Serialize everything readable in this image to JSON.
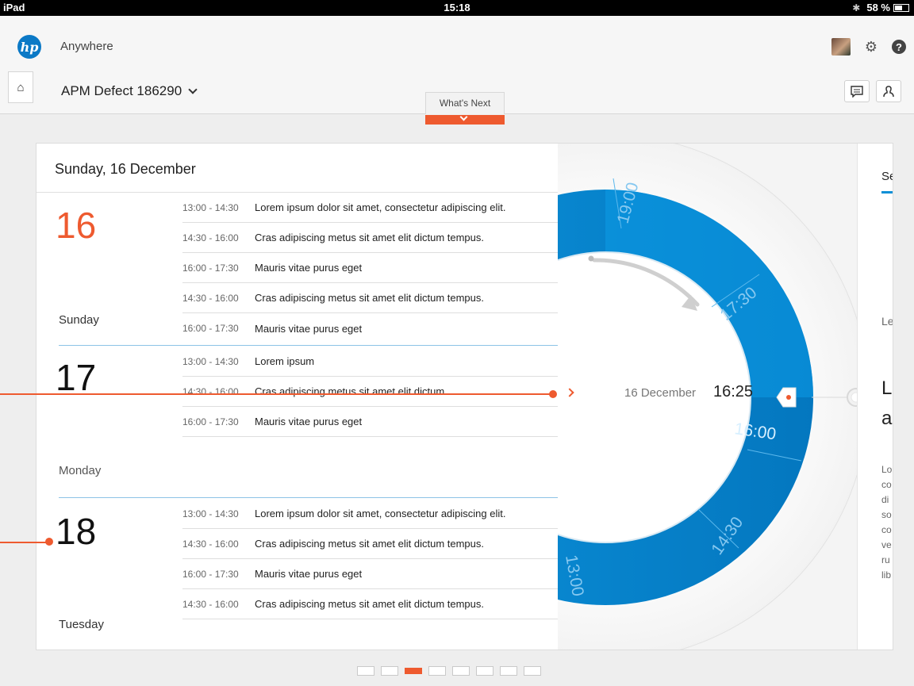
{
  "status_bar": {
    "device": "iPad",
    "time": "15:18",
    "battery": "58 %",
    "battery_level": 0.58
  },
  "app": {
    "logo": "hp",
    "name": "Anywhere"
  },
  "header_icons": [
    "avatar",
    "gear-icon",
    "help-icon"
  ],
  "sub_header": {
    "title": "APM Defect 186290",
    "whats_next": "What's Next"
  },
  "calendar": {
    "title": "Sunday, 16 December",
    "days": [
      {
        "number": "16",
        "name": "Sunday",
        "color": "#ee5a2f",
        "events": [
          {
            "time": "13:00 - 14:30",
            "title": "Lorem ipsum dolor sit amet, consectetur adipiscing elit."
          },
          {
            "time": "14:30 - 16:00",
            "title": "Cras adipiscing metus sit amet elit dictum tempus."
          },
          {
            "time": "16:00 - 17:30",
            "title": "Mauris vitae purus eget"
          },
          {
            "time": "14:30 - 16:00",
            "title": "Cras adipiscing metus sit amet elit dictum tempus."
          },
          {
            "time": "16:00 - 17:30",
            "title": "Mauris vitae purus eget"
          }
        ]
      },
      {
        "number": "17",
        "name": "Monday",
        "color": "#111111",
        "events": [
          {
            "time": "13:00 - 14:30",
            "title": "Lorem ipsum"
          },
          {
            "time": "14:30 - 16:00",
            "title": "Cras adipiscing metus sit amet elit dictum"
          },
          {
            "time": "16:00 - 17:30",
            "title": "Mauris vitae purus eget"
          }
        ]
      },
      {
        "number": "18",
        "name": "Tuesday",
        "color": "#111111",
        "events": [
          {
            "time": "13:00 - 14:30",
            "title": "Lorem ipsum dolor sit amet, consectetur adipiscing elit."
          },
          {
            "time": "14:30 - 16:00",
            "title": "Cras adipiscing metus sit amet elit dictum tempus."
          },
          {
            "time": "16:00 - 17:30",
            "title": "Mauris vitae purus eget"
          },
          {
            "time": "14:30 - 16:00",
            "title": "Cras adipiscing metus sit amet elit dictum tempus."
          }
        ]
      }
    ]
  },
  "dial": {
    "date": "16 December",
    "time": "16:25",
    "slots": [
      "19:00",
      "17:30",
      "16:00",
      "14:30",
      "13:00"
    ],
    "colors": {
      "ring": "#0a8fd8",
      "ring_dark": "#0477bf",
      "accent": "#ee5a2f"
    }
  },
  "side_panel": {
    "tab": "Se",
    "label": "Le",
    "big_line1": "L",
    "big_line2": "a",
    "text_lines": [
      "Lo",
      "co",
      "di",
      "so",
      "co",
      "ve",
      "ru",
      "lib"
    ]
  },
  "pager": {
    "count": 8,
    "active": 3
  }
}
